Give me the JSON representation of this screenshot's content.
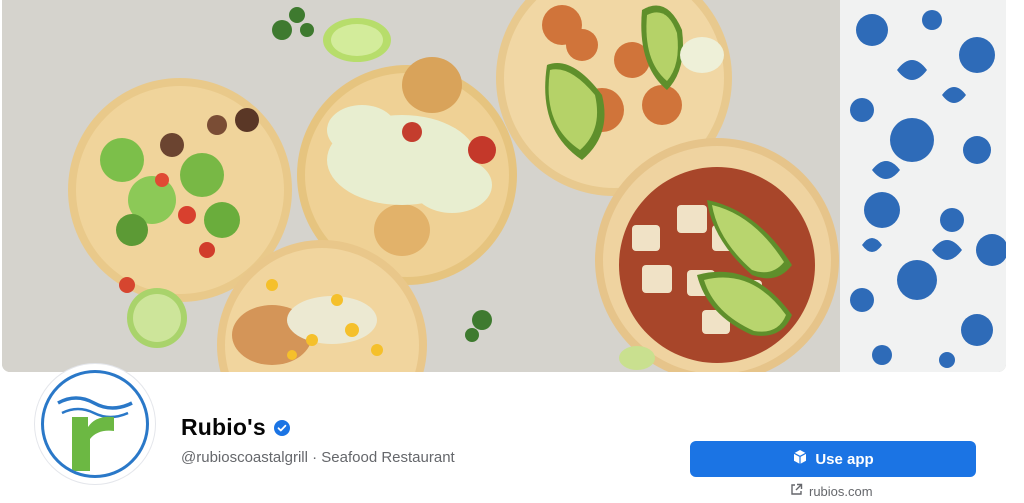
{
  "page": {
    "name": "Rubio's",
    "handle_line": "@rubioscoastalgrill · Seafood Restaurant"
  },
  "actions": {
    "use_app_label": "Use app",
    "website_label": "rubios.com"
  },
  "icons": {
    "verified": "verified-badge-icon",
    "use_app": "cube-icon",
    "website": "external-link-icon"
  },
  "colors": {
    "brand_blue": "#1b74e4",
    "logo_green": "#6cb843",
    "logo_ring": "#2a78c8"
  }
}
